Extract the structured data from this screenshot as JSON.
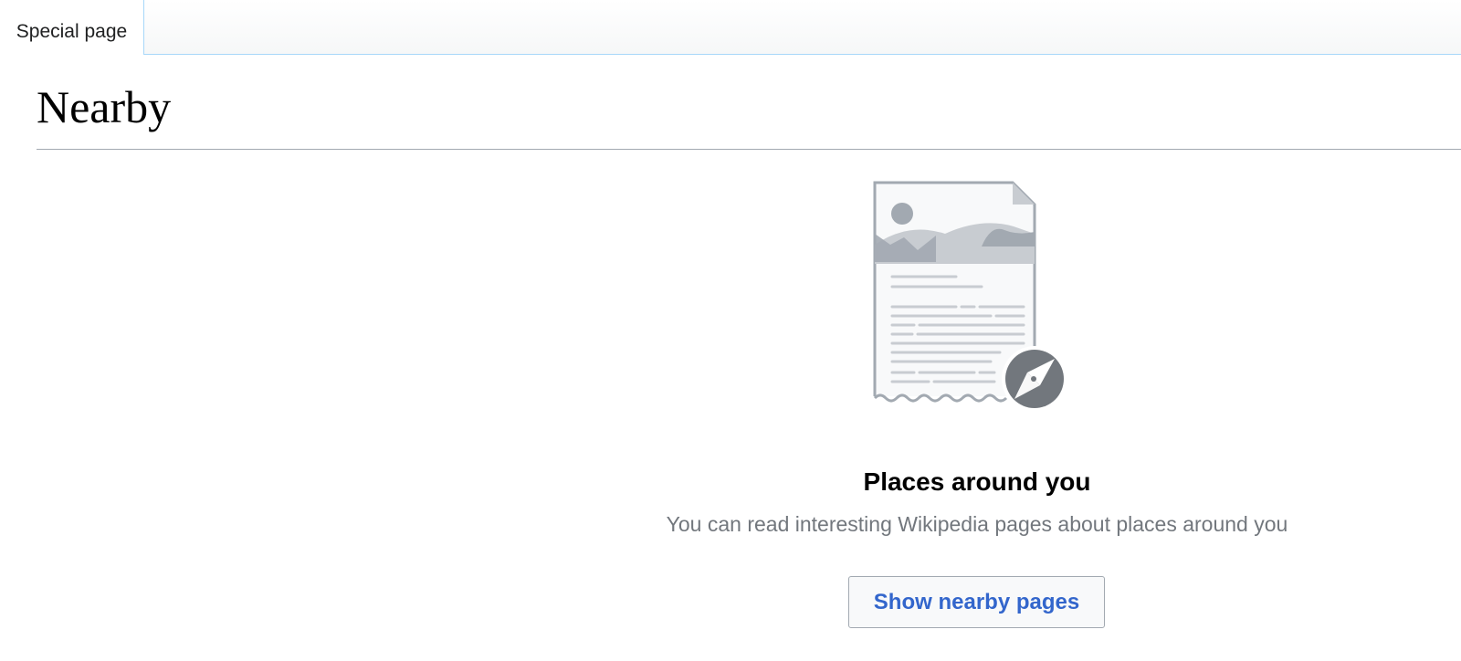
{
  "tabs": {
    "special_page_label": "Special page"
  },
  "page": {
    "title": "Nearby"
  },
  "empty_state": {
    "illustration_icon": "nearby-document-compass-icon",
    "heading": "Places around you",
    "description": "You can read interesting Wikipedia pages about places around you",
    "button_label": "Show nearby pages"
  },
  "colors": {
    "link_blue": "#3366cc",
    "tab_border": "#a7d7f9",
    "muted_text": "#72777d",
    "rule_gray": "#a2a9b1"
  }
}
